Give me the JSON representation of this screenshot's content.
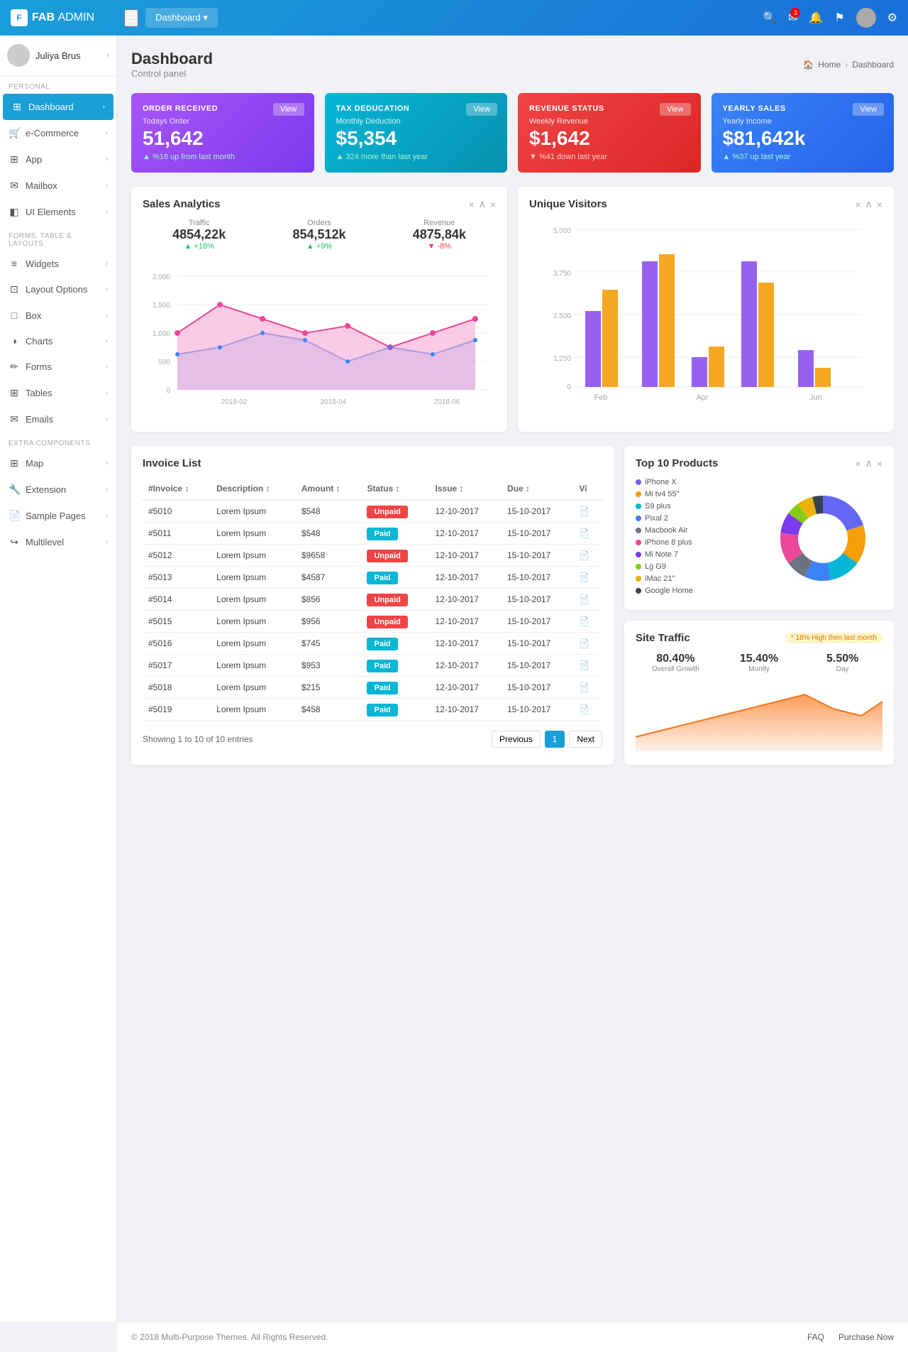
{
  "app": {
    "name": "FAB ADMIN",
    "logo_text": "FAB",
    "sub_text": "ADMIN"
  },
  "header": {
    "dashboard_btn": "Dashboard ▾",
    "menu_icon": "☰"
  },
  "user": {
    "name": "Juliya Brus"
  },
  "breadcrumb": {
    "home": "Home",
    "current": "Dashboard"
  },
  "page_title": "Dashboard",
  "page_subtitle": "Control panel",
  "sidebar": {
    "section1_label": "PERSONAL",
    "section2_label": "FORMS, TABLE & LAYOUTS",
    "section3_label": "EXTRA COMPONENTS",
    "items": [
      {
        "id": "dashboard",
        "label": "Dashboard",
        "icon": "⊞",
        "active": true
      },
      {
        "id": "ecommerce",
        "label": "e-Commerce",
        "icon": "🛒"
      },
      {
        "id": "app",
        "label": "App",
        "icon": "⊞"
      },
      {
        "id": "mailbox",
        "label": "Mailbox",
        "icon": "✉"
      },
      {
        "id": "ui-elements",
        "label": "UI Elements",
        "icon": "◧"
      },
      {
        "id": "widgets",
        "label": "Widgets",
        "icon": "≡"
      },
      {
        "id": "layout-options",
        "label": "Layout Options",
        "icon": "⊡"
      },
      {
        "id": "box",
        "label": "Box",
        "icon": "□"
      },
      {
        "id": "charts",
        "label": "Charts",
        "icon": "◑"
      },
      {
        "id": "forms",
        "label": "Forms",
        "icon": "✏"
      },
      {
        "id": "tables",
        "label": "Tables",
        "icon": "⊞"
      },
      {
        "id": "emails",
        "label": "Emails",
        "icon": "✉"
      },
      {
        "id": "map",
        "label": "Map",
        "icon": "⊞"
      },
      {
        "id": "extension",
        "label": "Extension",
        "icon": "🔧"
      },
      {
        "id": "sample-pages",
        "label": "Sample Pages",
        "icon": "📄"
      },
      {
        "id": "multilevel",
        "label": "Multilevel",
        "icon": "↪"
      }
    ]
  },
  "stat_cards": [
    {
      "id": "order-received",
      "color": "purple",
      "title": "ORDER RECEIVED",
      "view_label": "View",
      "sub": "Todays Order",
      "value": "51,642",
      "trend_text": "▲ %18 up from last month",
      "trend_dir": "up"
    },
    {
      "id": "tax-deduction",
      "color": "teal",
      "title": "TAX DEDUCATION",
      "view_label": "View",
      "sub": "Monthly Deduction",
      "value": "$5,354",
      "trend_text": "▲ 324 more than last year",
      "trend_dir": "up"
    },
    {
      "id": "revenue-status",
      "color": "red",
      "title": "REVENUE STATUS",
      "view_label": "View",
      "sub": "Weekly Revenue",
      "value": "$1,642",
      "trend_text": "▼ %41 down last year",
      "trend_dir": "down"
    },
    {
      "id": "yearly-sales",
      "color": "blue",
      "title": "YEARLY SALES",
      "view_label": "View",
      "sub": "Yearly Income",
      "value": "$81,642k",
      "trend_text": "▲ %37 up last year",
      "trend_dir": "up"
    }
  ],
  "sales_analytics": {
    "title": "Sales Analytics",
    "stats": [
      {
        "label": "Traffic",
        "value": "4854,22k",
        "trend": "+18%",
        "dir": "up"
      },
      {
        "label": "Orders",
        "value": "854,512k",
        "trend": "+9%",
        "dir": "up"
      },
      {
        "label": "Revenue",
        "value": "4875,84k",
        "trend": "-8%",
        "dir": "down"
      }
    ]
  },
  "unique_visitors": {
    "title": "Unique Visitors"
  },
  "invoice": {
    "title": "Invoice List",
    "columns": [
      "#Invoice",
      "Description",
      "Amount",
      "Status",
      "Issue",
      "Due",
      "Vi"
    ],
    "rows": [
      {
        "id": "#5010",
        "desc": "Lorem Ipsum",
        "amount": "$548",
        "status": "Unpaid",
        "issue": "12-10-2017",
        "due": "15-10-2017"
      },
      {
        "id": "#5011",
        "desc": "Lorem Ipsum",
        "amount": "$548",
        "status": "Paid",
        "issue": "12-10-2017",
        "due": "15-10-2017"
      },
      {
        "id": "#5012",
        "desc": "Lorem Ipsum",
        "amount": "$9658",
        "status": "Unpaid",
        "issue": "12-10-2017",
        "due": "15-10-2017"
      },
      {
        "id": "#5013",
        "desc": "Lorem Ipsum",
        "amount": "$4587",
        "status": "Paid",
        "issue": "12-10-2017",
        "due": "15-10-2017"
      },
      {
        "id": "#5014",
        "desc": "Lorem Ipsum",
        "amount": "$856",
        "status": "Unpaid",
        "issue": "12-10-2017",
        "due": "15-10-2017"
      },
      {
        "id": "#5015",
        "desc": "Lorem Ipsum",
        "amount": "$956",
        "status": "Unpaid",
        "issue": "12-10-2017",
        "due": "15-10-2017"
      },
      {
        "id": "#5016",
        "desc": "Lorem Ipsum",
        "amount": "$745",
        "status": "Paid",
        "issue": "12-10-2017",
        "due": "15-10-2017"
      },
      {
        "id": "#5017",
        "desc": "Lorem Ipsum",
        "amount": "$953",
        "status": "Paid",
        "issue": "12-10-2017",
        "due": "15-10-2017"
      },
      {
        "id": "#5018",
        "desc": "Lorem Ipsum",
        "amount": "$215",
        "status": "Paid",
        "issue": "12-10-2017",
        "due": "15-10-2017"
      },
      {
        "id": "#5019",
        "desc": "Lorem Ipsum",
        "amount": "$458",
        "status": "Paid",
        "issue": "12-10-2017",
        "due": "15-10-2017"
      }
    ],
    "showing": "Showing 1 to 10 of 10 entries",
    "prev_label": "Previous",
    "next_label": "Next",
    "page_num": "1"
  },
  "top10_products": {
    "title": "Top 10 Products",
    "legend": [
      {
        "color": "#6366f1",
        "label": "iPhone X"
      },
      {
        "color": "#f59e0b",
        "label": "Mi tv4 55\""
      },
      {
        "color": "#06b6d4",
        "label": "S9 plus"
      },
      {
        "color": "#3b82f6",
        "label": "Pixal 2"
      },
      {
        "color": "#6b7280",
        "label": "Macbook Air"
      },
      {
        "color": "#ec4899",
        "label": "iPhone 8 plus"
      },
      {
        "color": "#7c3aed",
        "label": "Mi Note 7"
      },
      {
        "color": "#84cc16",
        "label": "Lg G9"
      },
      {
        "color": "#eab308",
        "label": "iMac 21\""
      },
      {
        "color": "#374151",
        "label": "Google Home"
      }
    ],
    "pie_segments": [
      {
        "color": "#6366f1",
        "pct": 20
      },
      {
        "color": "#f59e0b",
        "pct": 15
      },
      {
        "color": "#06b6d4",
        "pct": 12
      },
      {
        "color": "#3b82f6",
        "pct": 10
      },
      {
        "color": "#6b7280",
        "pct": 8
      },
      {
        "color": "#ec4899",
        "pct": 12
      },
      {
        "color": "#7c3aed",
        "pct": 8
      },
      {
        "color": "#84cc16",
        "pct": 5
      },
      {
        "color": "#eab308",
        "pct": 6
      },
      {
        "color": "#374151",
        "pct": 4
      }
    ]
  },
  "site_traffic": {
    "title": "Site Traffic",
    "badge": "* 18% High then last month",
    "stats": [
      {
        "value": "80.40%",
        "label": "Overall Growth"
      },
      {
        "value": "15.40%",
        "label": "Montly"
      },
      {
        "value": "5.50%",
        "label": "Day"
      }
    ]
  },
  "footer": {
    "copyright": "© 2018 Multi-Purpose Themes. All Rights Reserved.",
    "links": [
      "FAQ",
      "Purchase Now"
    ]
  }
}
